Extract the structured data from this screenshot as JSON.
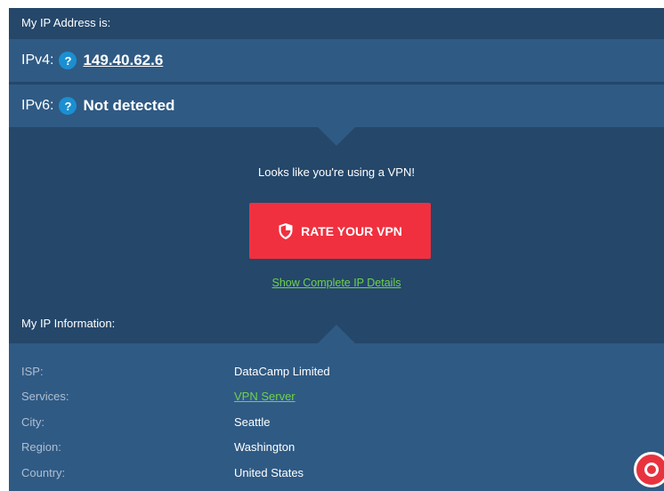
{
  "header": {
    "my_ip_title": "My IP Address is:"
  },
  "ipv4": {
    "label": "IPv4:",
    "help": "?",
    "value": "149.40.62.6"
  },
  "ipv6": {
    "label": "IPv6:",
    "help": "?",
    "value": "Not detected"
  },
  "vpn": {
    "message": "Looks like you're using a VPN!",
    "rate_button_label": "RATE YOUR VPN",
    "details_link": "Show Complete IP Details"
  },
  "info": {
    "title": "My IP Information:",
    "rows": [
      {
        "key": "ISP:",
        "value": "DataCamp Limited"
      },
      {
        "key": "Services:",
        "value": "VPN Server"
      },
      {
        "key": "City:",
        "value": "Seattle"
      },
      {
        "key": "Region:",
        "value": "Washington"
      },
      {
        "key": "Country:",
        "value": "United States"
      }
    ]
  },
  "icons": {
    "help": "question-icon",
    "shield": "shield-icon",
    "chat": "chat-icon"
  },
  "colors": {
    "panel_dark": "#24476a",
    "panel_light": "#2f5a84",
    "accent_red": "#f0303f",
    "help_blue": "#1b8fd1",
    "link_green": "#6fd24b"
  }
}
